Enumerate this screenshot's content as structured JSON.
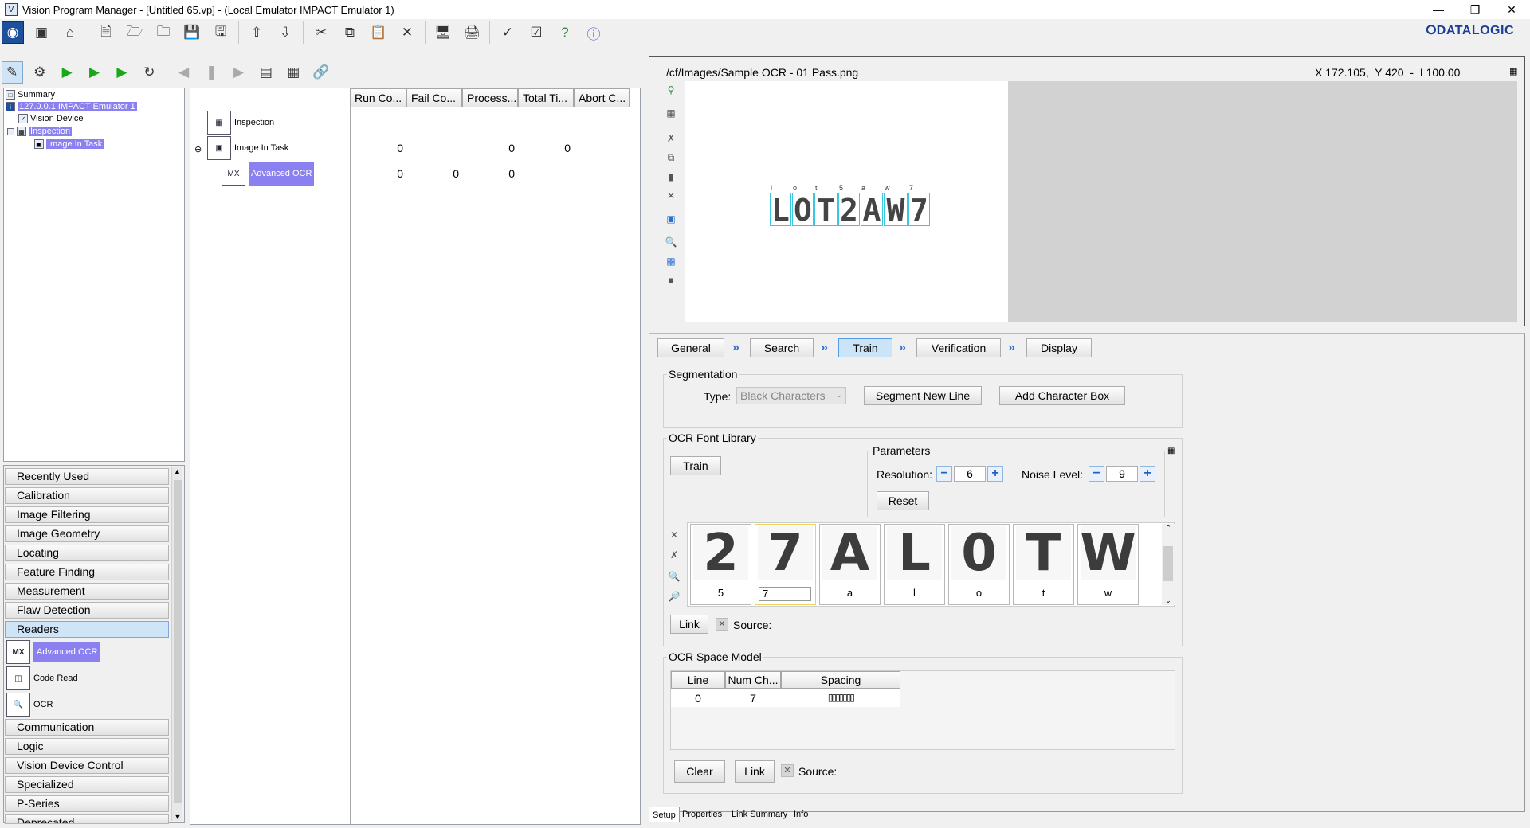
{
  "window": {
    "title": "Vision Program Manager - [Untitled 65.vp] - (Local Emulator IMPACT Emulator 1)",
    "minimize_glyph": "—",
    "restore_glyph": "❒",
    "close_glyph": "✕"
  },
  "brand": "⭘DATALOGIC",
  "tree": {
    "summary": "Summary",
    "device_ip": "127.0.0.1 IMPACT Emulator 1",
    "vision_device": "Vision Device",
    "inspection": "Inspection",
    "image_in_task": "Image In Task"
  },
  "categories": [
    "Recently Used",
    "Calibration",
    "Image Filtering",
    "Image Geometry",
    "Locating",
    "Feature Finding",
    "Measurement",
    "Flaw Detection",
    "Readers",
    "Communication",
    "Logic",
    "Vision Device Control",
    "Specialized",
    "P-Series",
    "Deprecated"
  ],
  "readers_tools": [
    "Advanced OCR",
    "Code Read",
    "OCR"
  ],
  "grid": {
    "columns": [
      "Run Co...",
      "Fail Co...",
      "Process...",
      "Total Ti...",
      "Abort C..."
    ],
    "rows": [
      {
        "name": "Inspection",
        "values": [
          "",
          "",
          "",
          "",
          ""
        ]
      },
      {
        "name": "Image In Task",
        "values": [
          "0",
          "",
          "0",
          "0",
          ""
        ]
      },
      {
        "name": "Advanced OCR",
        "values": [
          "0",
          "0",
          "0",
          "",
          ""
        ]
      }
    ]
  },
  "image_viewer": {
    "path": "/cf/Images/Sample OCR - 01 Pass.png",
    "coords": "X 172.105,  Y 420  -  I 100.00",
    "ocr_text": "LOT2AW7",
    "ocr_labels": [
      "l",
      "o",
      "t",
      "5",
      "a",
      "w",
      "7"
    ]
  },
  "tabs": [
    "General",
    "Search",
    "Train",
    "Verification",
    "Display"
  ],
  "active_tab": "Train",
  "segmentation": {
    "legend": "Segmentation",
    "type_label": "Type:",
    "type_value": "Black Characters",
    "segment_new_line": "Segment New Line",
    "add_character_box": "Add Character Box"
  },
  "font_library": {
    "legend": "OCR Font Library",
    "train_button": "Train",
    "parameters_legend": "Parameters",
    "resolution_label": "Resolution:",
    "resolution_value": "6",
    "noise_label": "Noise Level:",
    "noise_value": "9",
    "reset_button": "Reset",
    "glyphs": [
      {
        "char": "2",
        "label": "5"
      },
      {
        "char": "7",
        "label": "7"
      },
      {
        "char": "A",
        "label": "a"
      },
      {
        "char": "L",
        "label": "l"
      },
      {
        "char": "0",
        "label": "o"
      },
      {
        "char": "T",
        "label": "t"
      },
      {
        "char": "W",
        "label": "w"
      }
    ],
    "link_button": "Link",
    "source_label": "Source:"
  },
  "space_model": {
    "legend": "OCR Space Model",
    "columns": [
      "Line",
      "Num Ch...",
      "Spacing"
    ],
    "rows": [
      {
        "line": "0",
        "num": "7",
        "spacing": "▯▯▯▯▯▯▯"
      }
    ],
    "clear_button": "Clear",
    "link_button": "Link",
    "source_label": "Source:"
  },
  "bottom_tabs": [
    "Setup",
    "Properties",
    "Link Summary",
    "Info"
  ]
}
